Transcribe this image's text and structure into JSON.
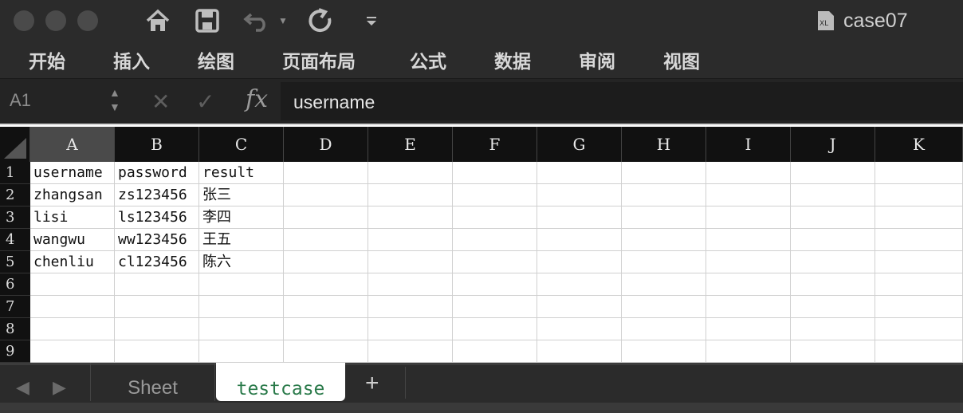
{
  "titlebar": {
    "doc_name": "case07",
    "quick_access": [
      "home-icon",
      "save-icon",
      "undo-icon",
      "undo-dropdown-icon",
      "redo-icon",
      "customize-icon"
    ]
  },
  "ribbon": {
    "tabs": [
      "开始",
      "插入",
      "绘图",
      "页面布局",
      "公式",
      "数据",
      "审阅",
      "视图"
    ]
  },
  "formula_bar": {
    "cell_ref": "A1",
    "fx_label": "fx",
    "value": "username"
  },
  "grid": {
    "columns": [
      "A",
      "B",
      "C",
      "D",
      "E",
      "F",
      "G",
      "H",
      "I",
      "J",
      "K"
    ],
    "selected_column": "A",
    "rows": [
      "1",
      "2",
      "3",
      "4",
      "5",
      "6",
      "7",
      "8",
      "9"
    ],
    "cells": [
      [
        "username",
        "password",
        "result"
      ],
      [
        "zhangsan",
        "zs123456",
        "张三"
      ],
      [
        "lisi",
        "ls123456",
        "李四"
      ],
      [
        "wangwu",
        "ww123456",
        "王五"
      ],
      [
        "chenliu",
        "cl123456",
        "陈六"
      ]
    ]
  },
  "sheets": {
    "tabs": [
      "Sheet",
      "testcase"
    ],
    "active": "testcase",
    "add_label": "+"
  }
}
